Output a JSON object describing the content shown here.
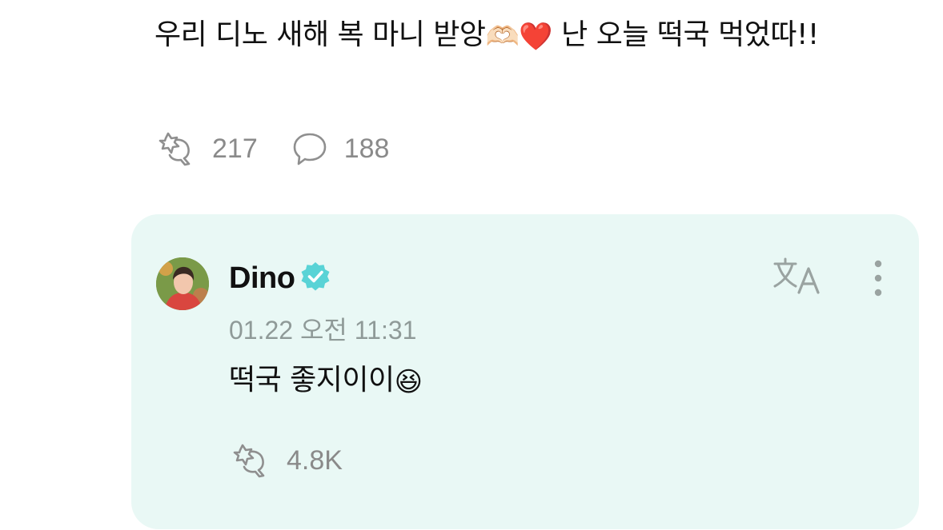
{
  "post": {
    "text_part1": "우리 디노 새해 복 마니 받앙",
    "emoji_heart_hands": "🫶🏻",
    "emoji_red_heart": "❤️",
    "text_part2": " 난 오늘 떡국 먹었따!!",
    "like_icon": "like-icon",
    "like_count": "217",
    "comment_icon": "comment-icon",
    "comment_count": "188"
  },
  "reply": {
    "author": "Dino",
    "verified_icon": "verified-badge-icon",
    "timestamp": "01.22 오전 11:31",
    "text": "떡국 좋지이이",
    "emoji": "😆",
    "like_count": "4.8K",
    "translate_icon": "translate-icon",
    "more_icon": "more-vertical-icon"
  },
  "colors": {
    "card_background": "#e9f8f5",
    "verified": "#59d3d6",
    "muted_text": "#8a8a8a",
    "icon_gray": "#9aa3a1"
  }
}
